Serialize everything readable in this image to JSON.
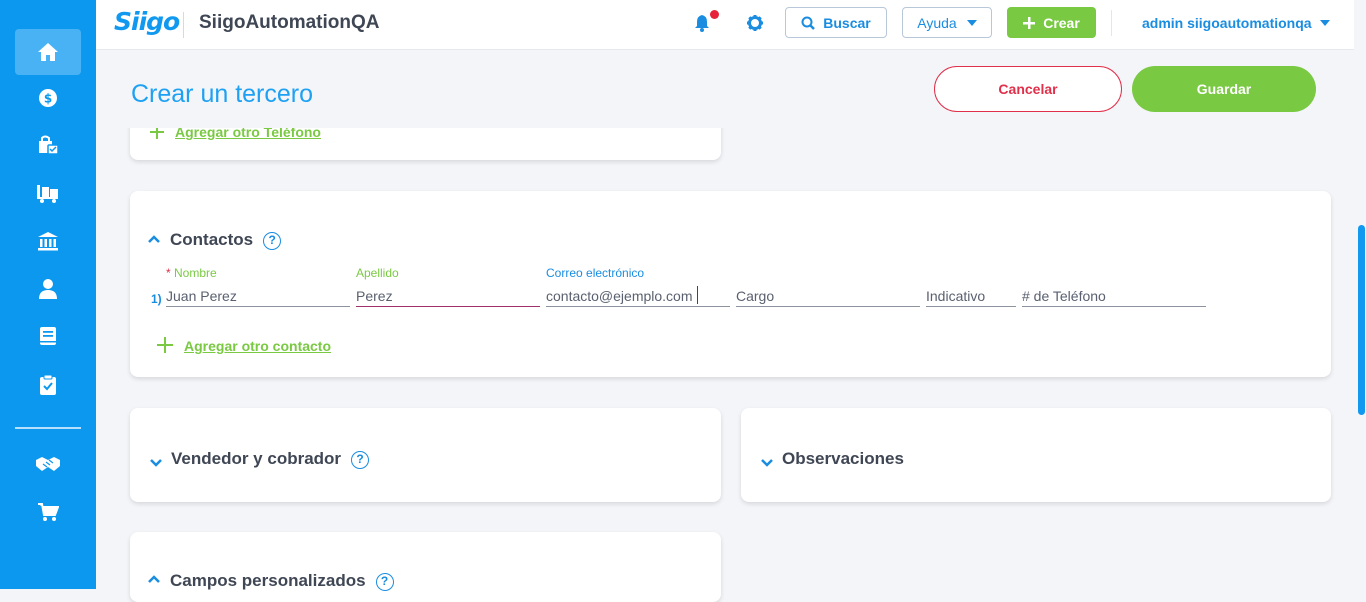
{
  "app": {
    "logo_text": "Siigo",
    "company_name": "SiigoAutomationQA",
    "accent_color": "#0d98f0",
    "green_color": "#7ac943"
  },
  "sidebar": {
    "items": [
      {
        "icon": "home-icon",
        "active": true
      },
      {
        "icon": "dollar-icon"
      },
      {
        "icon": "shopping-bag-icon"
      },
      {
        "icon": "truck-cart-icon"
      },
      {
        "icon": "bank-icon"
      },
      {
        "icon": "user-icon"
      },
      {
        "icon": "book-icon"
      },
      {
        "icon": "clipboard-check-icon"
      },
      {
        "icon": "handshake-icon"
      },
      {
        "icon": "cart-icon"
      }
    ]
  },
  "topbar": {
    "search_label": "Buscar",
    "help_label": "Ayuda",
    "create_label": "Crear",
    "user_label": "admin siigoautomationqa"
  },
  "page": {
    "title": "Crear un tercero",
    "cancel_label": "Cancelar",
    "save_label": "Guardar"
  },
  "phone_section": {
    "add_phone_link": "Agregar otro Teléfono"
  },
  "contacts": {
    "title": "Contactos",
    "help_glyph": "?",
    "row_number": "1)",
    "fields": {
      "nombre": {
        "label": "Nombre",
        "required_mark": "*",
        "value": "Juan Perez"
      },
      "apellido": {
        "label": "Apellido",
        "value": "Perez"
      },
      "correo": {
        "label": "Correo electrónico",
        "value": "contacto@ejemplo.com"
      },
      "cargo": {
        "placeholder": "Cargo"
      },
      "indicativo": {
        "placeholder": "Indicativo"
      },
      "telefono": {
        "placeholder": "# de Teléfono"
      }
    },
    "add_contact_link": "Agregar otro contacto"
  },
  "sections": {
    "vendedor": {
      "title": "Vendedor y cobrador",
      "help_glyph": "?"
    },
    "observaciones": {
      "title": "Observaciones"
    },
    "campos": {
      "title": "Campos personalizados",
      "help_glyph": "?"
    }
  }
}
